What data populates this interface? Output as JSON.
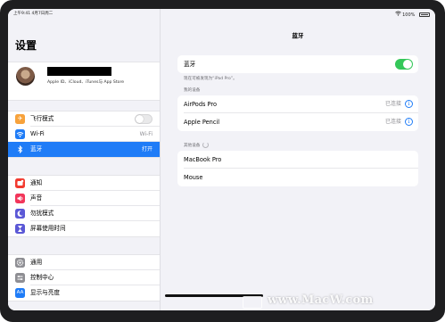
{
  "status_bar": {
    "time_date": "上午9:41   4月7日周二",
    "battery": "100%"
  },
  "sidebar": {
    "title": "设置",
    "profile": {
      "subtitle": "Apple ID、iCloud、iTunes与 App Store"
    },
    "group1": [
      {
        "label": "飞行模式",
        "icon": "airplane-icon",
        "color": "#f7a23b",
        "glyph": "✈",
        "toggle": "off"
      },
      {
        "label": "Wi-Fi",
        "icon": "wifi-icon",
        "color": "#1f7cf7",
        "glyph": "≈",
        "value": "Wi-Fi"
      },
      {
        "label": "蓝牙",
        "icon": "bluetooth-icon",
        "color": "#1f7cf7",
        "glyph": "ᛒ",
        "value": "打开",
        "active": true
      }
    ],
    "group2": [
      {
        "label": "通知",
        "icon": "notifications-icon",
        "color": "#f23b30",
        "glyph": "■"
      },
      {
        "label": "声音",
        "icon": "sound-icon",
        "color": "#f2365a",
        "glyph": "◀"
      },
      {
        "label": "勿扰模式",
        "icon": "moon-icon",
        "color": "#5b58d6",
        "glyph": "☾"
      },
      {
        "label": "屏幕使用时间",
        "icon": "hourglass-icon",
        "color": "#5b58d6",
        "glyph": "⧗"
      }
    ],
    "group3": [
      {
        "label": "通用",
        "icon": "gear-icon",
        "color": "#8e8e93",
        "glyph": "⚙"
      },
      {
        "label": "控制中心",
        "icon": "control-center-icon",
        "color": "#8e8e93",
        "glyph": "≡"
      },
      {
        "label": "显示与亮度",
        "icon": "display-icon",
        "color": "#1f7cf7",
        "glyph": "AA"
      }
    ]
  },
  "main": {
    "title": "蓝牙",
    "bluetooth_label": "蓝牙",
    "bluetooth_toggle": "on",
    "discoverable_note": "现在可被发现为“iPad Pro”。",
    "my_devices_header": "我的设备",
    "my_devices": [
      {
        "name": "AirPods Pro",
        "status": "已连接"
      },
      {
        "name": "Apple Pencil",
        "status": "已连接"
      }
    ],
    "other_devices_header": "其他设备",
    "other_devices": [
      {
        "name": "MacBook Pro"
      },
      {
        "name": "Mouse"
      }
    ]
  },
  "watermark": "www.MacW.com",
  "colors": {
    "accent": "#1f7cf7",
    "toggle_on": "#34c759",
    "background": "#f2f2f7"
  }
}
